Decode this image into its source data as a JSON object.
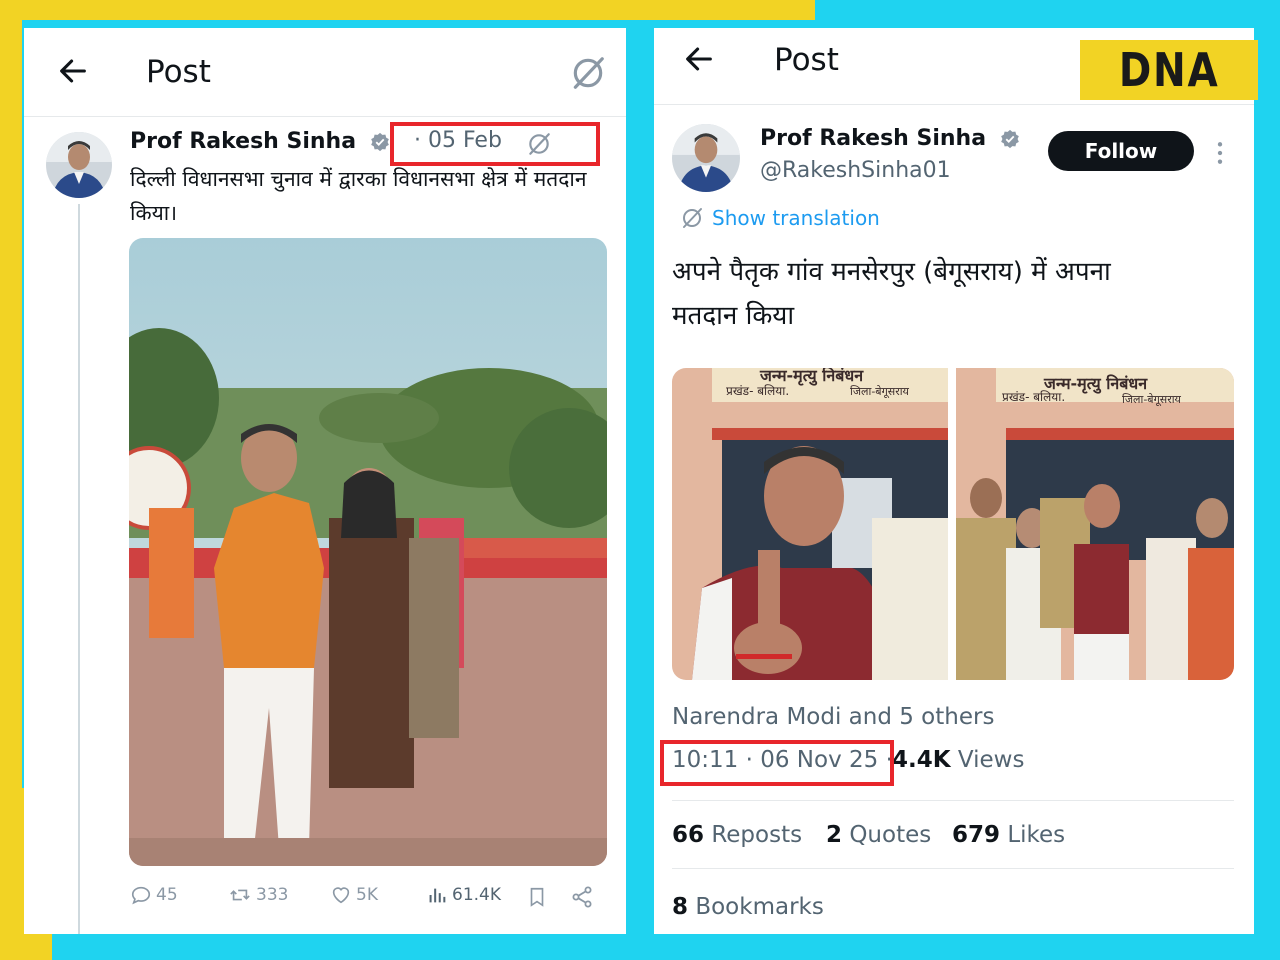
{
  "left_post": {
    "header_title": "Post",
    "author_name": "Prof Rakesh Sinha",
    "date": "· 05 Feb",
    "text": "दिल्ली विधानसभा चुनाव में द्वारका विधानसभा क्षेत्र में मतदान किया।",
    "actions": {
      "replies": "45",
      "reposts": "333",
      "likes": "5K",
      "views": "61.4K"
    }
  },
  "right_post": {
    "header_title": "Post",
    "author_name": "Prof Rakesh Sinha",
    "handle": "@RakeshSinha01",
    "follow_label": "Follow",
    "show_translation": "Show translation",
    "text_line1": "अपने पैतृक गांव मनसेरपुर (बेगूसराय) में अपना",
    "text_line2": "मतदान किया",
    "photo_sign_line1": "जन्म-मृत्यु निबंधन",
    "photo_sign_line2": "प्रखंड- बलिया.",
    "photo_sign_line3": "जिला-बेगूसराय",
    "liked_by": "Narendra Modi and 5 others",
    "timestamp": "10:11 · 06 Nov 25 ·",
    "views_count": "4.4K",
    "views_label": "Views",
    "reposts_count": "66",
    "reposts_label": "Reposts",
    "quotes_count": "2",
    "quotes_label": "Quotes",
    "likes_count": "679",
    "likes_label": "Likes",
    "bookmarks_count": "8",
    "bookmarks_label": "Bookmarks"
  },
  "brand": {
    "logo": "DNA"
  },
  "colors": {
    "accent_blue": "#1d9bf0",
    "highlight_red": "#e8262b",
    "bg_cyan": "#1fd3f0",
    "bg_yellow": "#f2d324"
  },
  "icons": [
    "back-arrow-icon",
    "translate-icon",
    "verified-icon",
    "reply-icon",
    "repost-icon",
    "like-icon",
    "views-icon",
    "bookmark-icon",
    "share-icon",
    "more-icon"
  ]
}
